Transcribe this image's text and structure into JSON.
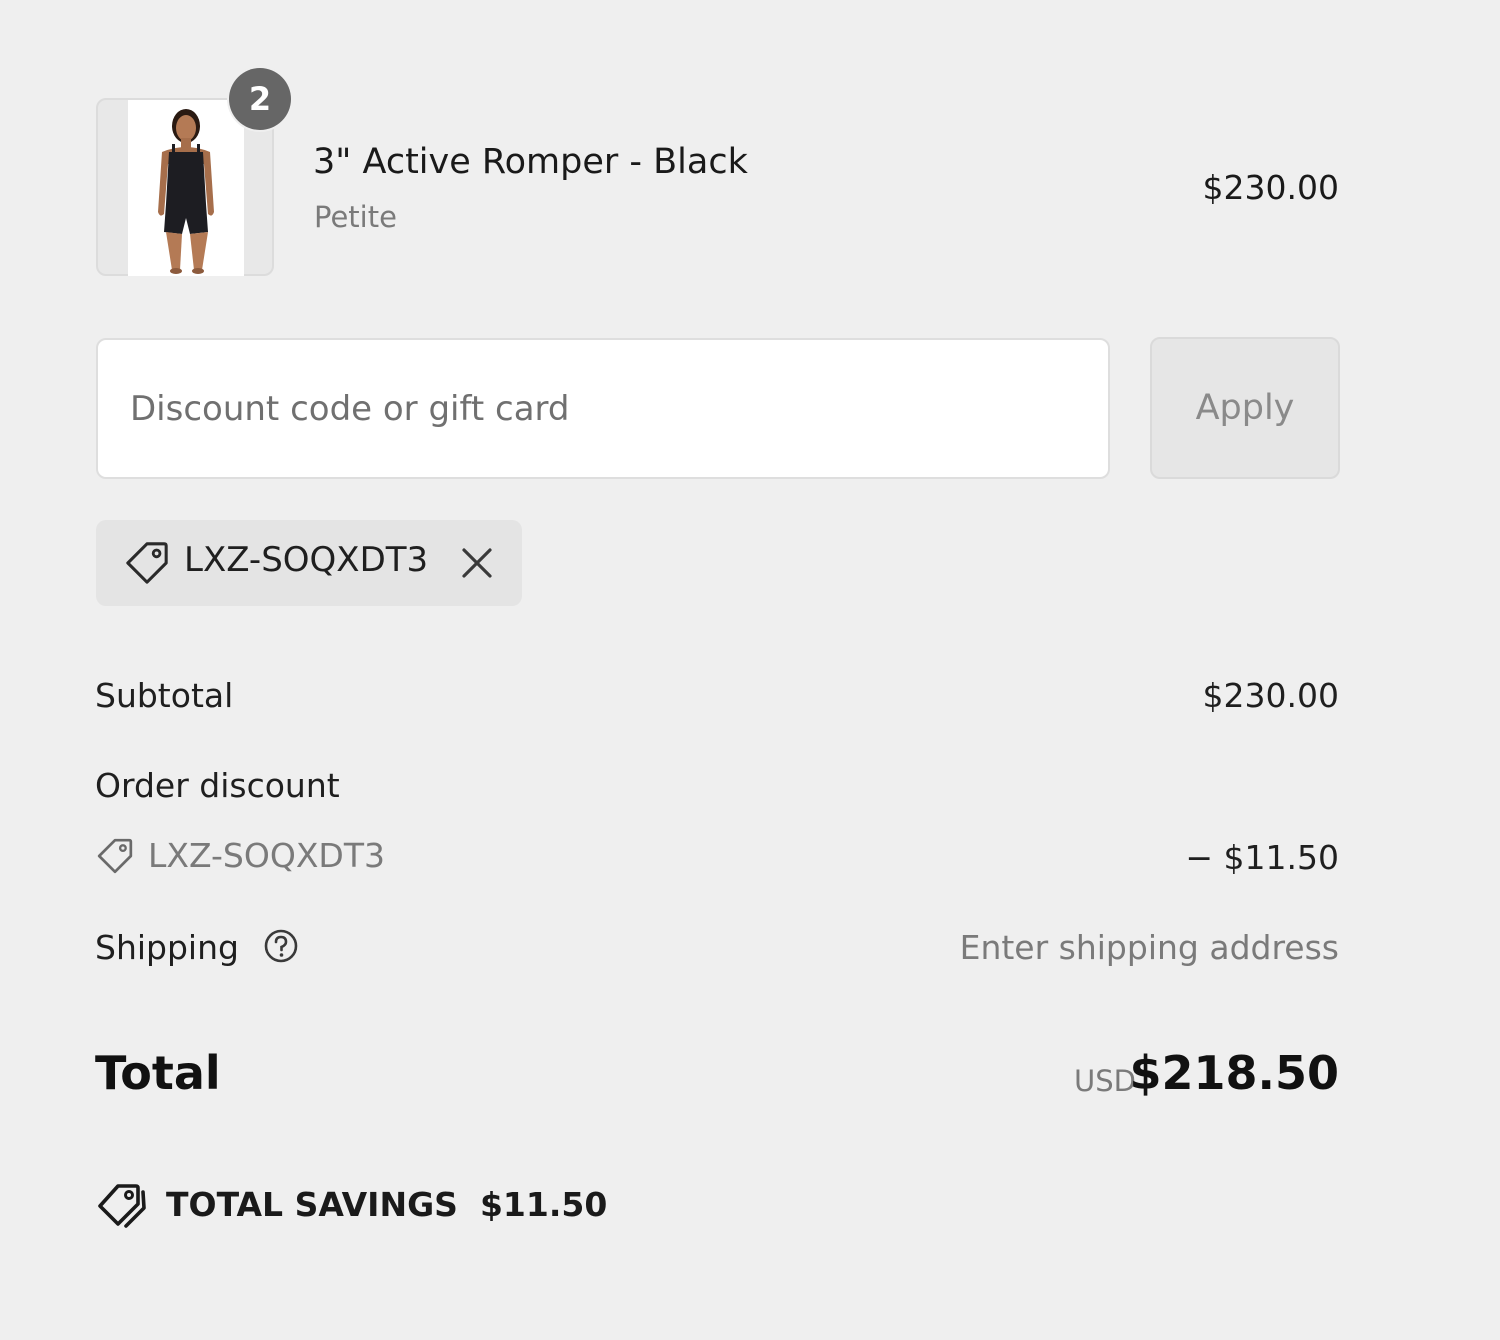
{
  "line_item": {
    "quantity": "2",
    "name": "3\" Active Romper - Black",
    "variant": "Petite",
    "price": "$230.00",
    "image_icon": "product-photo-romper"
  },
  "discount": {
    "placeholder": "Discount code or gift card",
    "value": "",
    "apply_label": "Apply"
  },
  "applied_code": {
    "code": "LXZ-SOQXDT3",
    "tag_icon": "tag-icon",
    "remove_icon": "close-icon"
  },
  "summary": {
    "subtotal_label": "Subtotal",
    "subtotal_value": "$230.00",
    "order_discount_label": "Order discount",
    "order_discount_code": "LXZ-SOQXDT3",
    "order_discount_value": "− $11.50",
    "shipping_label": "Shipping",
    "shipping_value": "Enter shipping address",
    "shipping_help_icon": "question-circle-icon"
  },
  "total": {
    "label": "Total",
    "currency": "USD",
    "amount": "$218.50"
  },
  "savings": {
    "icon": "double-tag-icon",
    "label": "TOTAL SAVINGS",
    "amount": "$11.50"
  },
  "colors": {
    "background": "#efefef",
    "badge": "#666666",
    "muted_text": "#7a7a7a",
    "text": "#1a1a1a"
  }
}
